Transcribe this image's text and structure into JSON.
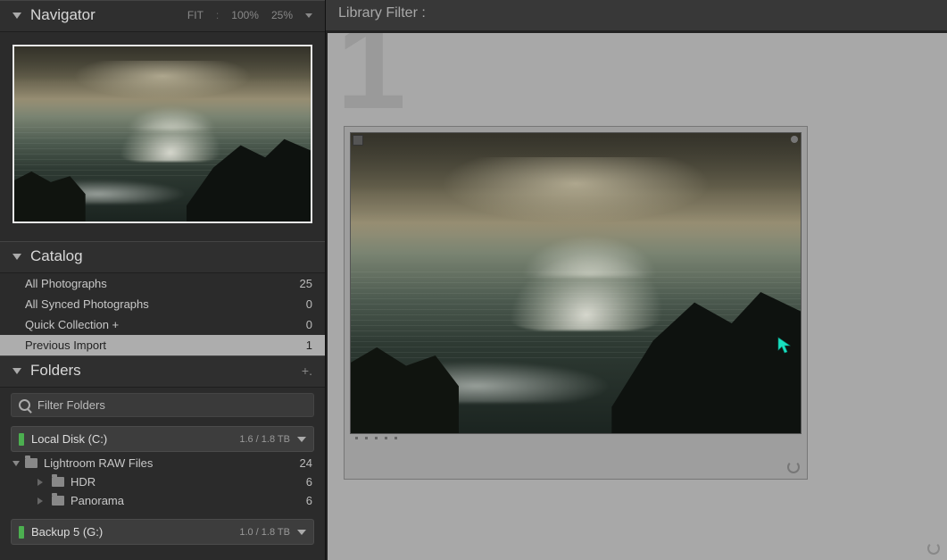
{
  "navigator": {
    "title": "Navigator",
    "zoom": {
      "fit": "FIT",
      "z100": "100%",
      "z25": "25%"
    }
  },
  "catalog": {
    "title": "Catalog",
    "items": [
      {
        "label": "All Photographs",
        "count": "25"
      },
      {
        "label": "All Synced Photographs",
        "count": "0"
      },
      {
        "label": "Quick Collection  +",
        "count": "0"
      },
      {
        "label": "Previous Import",
        "count": "1"
      }
    ]
  },
  "folders": {
    "title": "Folders",
    "add": "+.",
    "filter_label": "Filter Folders",
    "drives": [
      {
        "name": "Local Disk (C:)",
        "usage": "1.6 / 1.8 TB"
      },
      {
        "name": "Backup 5 (G:)",
        "usage": "1.0 / 1.8 TB"
      }
    ],
    "tree": [
      {
        "label": "Lightroom RAW Files",
        "count": "24",
        "level": 1
      },
      {
        "label": "HDR",
        "count": "6",
        "level": 2
      },
      {
        "label": "Panorama",
        "count": "6",
        "level": 2
      }
    ]
  },
  "library_filter": {
    "label": "Library Filter :"
  },
  "grid": {
    "index": "1"
  }
}
